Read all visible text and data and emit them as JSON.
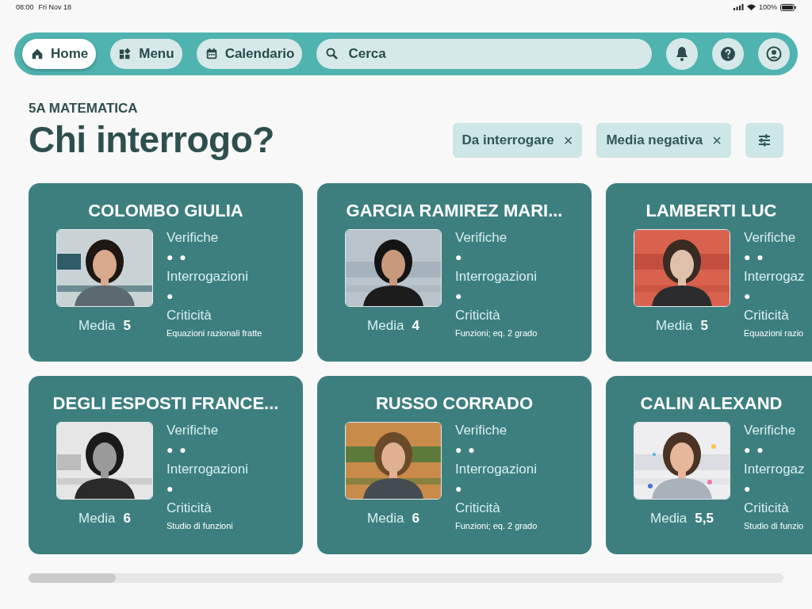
{
  "status_bar": {
    "time": "08:00",
    "date": "Fri Nov 18",
    "battery": "100%"
  },
  "nav": {
    "tabs": [
      {
        "label": "Home",
        "selected": true
      },
      {
        "label": "Menu",
        "selected": false
      },
      {
        "label": "Calendario",
        "selected": false
      }
    ],
    "search": {
      "placeholder": "Cerca"
    }
  },
  "class_name": "5A MATEMATICA",
  "title": "Chi interrogo?",
  "filters": [
    {
      "label": "Da interrogare",
      "remove": "×"
    },
    {
      "label": "Media negativa",
      "remove": "×"
    }
  ],
  "students": [
    {
      "name": "COLOMBO GIULIA",
      "verifiche_label": "Verifiche",
      "verifiche": "● ●",
      "interrogazioni_label": "Interrogazioni",
      "interrogazioni": "●",
      "criticita_label": "Criticità",
      "criticita": "Equazioni razionali fratte",
      "media_label": "Media",
      "media": "5"
    },
    {
      "name": "GARCIA RAMIREZ MARI...",
      "verifiche_label": "Verifiche",
      "verifiche": "●",
      "interrogazioni_label": "Interrogazioni",
      "interrogazioni": "●",
      "criticita_label": "Criticità",
      "criticita": "Funzioni; eq. 2 grado",
      "media_label": "Media",
      "media": "4"
    },
    {
      "name": "LAMBERTI LUC",
      "verifiche_label": "Verifiche",
      "verifiche": "● ●",
      "interrogazioni_label": "Interrogaz",
      "interrogazioni": "●",
      "criticita_label": "Criticità",
      "criticita": "Equazioni razio",
      "media_label": "Media",
      "media": "5"
    },
    {
      "name": "DEGLI ESPOSTI FRANCE...",
      "verifiche_label": "Verifiche",
      "verifiche": "● ●",
      "interrogazioni_label": "Interrogazioni",
      "interrogazioni": "●",
      "criticita_label": "Criticità",
      "criticita": "Studio di funzioni",
      "media_label": "Media",
      "media": "6"
    },
    {
      "name": "RUSSO CORRADO",
      "verifiche_label": "Verifiche",
      "verifiche": "● ●",
      "interrogazioni_label": "Interrogazioni",
      "interrogazioni": "●",
      "criticita_label": "Criticità",
      "criticita": "Funzioni; eq. 2 grado",
      "media_label": "Media",
      "media": "6"
    },
    {
      "name": "CALIN ALEXAND",
      "verifiche_label": "Verifiche",
      "verifiche": "● ●",
      "interrogazioni_label": "Interrogaz",
      "interrogazioni": "●",
      "criticita_label": "Criticità",
      "criticita": "Studio di funzio",
      "media_label": "Media",
      "media": "5,5"
    }
  ]
}
